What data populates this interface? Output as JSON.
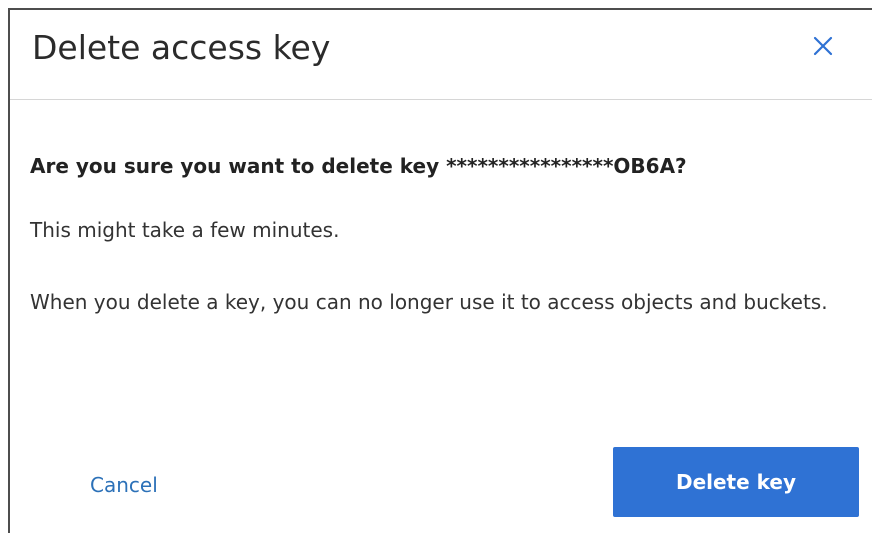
{
  "dialog": {
    "title": "Delete access key",
    "close_icon": "close-icon",
    "question": "Are you sure you want to delete key ****************OB6A?",
    "info": "This might take a few minutes.",
    "warning": "When you delete a key, you can no longer use it to access objects and buckets.",
    "cancel_label": "Cancel",
    "delete_label": "Delete key"
  },
  "colors": {
    "primary": "#2f72d4",
    "link": "#2c71b8",
    "close_icon": "#2f72d4"
  }
}
